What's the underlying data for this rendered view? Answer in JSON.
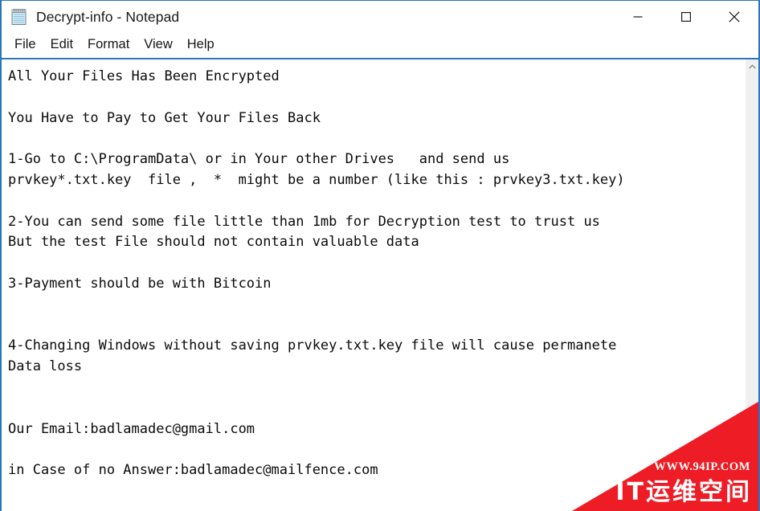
{
  "window": {
    "title": "Decrypt-info - Notepad",
    "icon": "notepad-icon",
    "controls": {
      "minimize_label": "Minimize",
      "maximize_label": "Maximize",
      "close_label": "Close"
    },
    "accent_color": "#2a76b8"
  },
  "menu": {
    "items": [
      {
        "label": "File"
      },
      {
        "label": "Edit"
      },
      {
        "label": "Format"
      },
      {
        "label": "View"
      },
      {
        "label": "Help"
      }
    ]
  },
  "document": {
    "lines": [
      "All Your Files Has Been Encrypted",
      "",
      "You Have to Pay to Get Your Files Back",
      "",
      "1-Go to C:\\ProgramData\\ or in Your other Drives   and send us",
      "prvkey*.txt.key  file ,  *  might be a number (like this : prvkey3.txt.key)",
      "",
      "2-You can send some file little than 1mb for Decryption test to trust us",
      "But the test File should not contain valuable data",
      "",
      "3-Payment should be with Bitcoin",
      "",
      "",
      "4-Changing Windows without saving prvkey.txt.key file will cause permanete",
      "Data loss",
      "",
      "",
      "Our Email:badlamadec@gmail.com",
      "",
      "in Case of no Answer:badlamadec@mailfence.com"
    ]
  },
  "scrollbar": {
    "up_arrow": "chevron-up-icon",
    "down_arrow": "chevron-down-icon"
  },
  "watermark": {
    "url_text": "WWW.94IP.COM",
    "brand_text": "IT运维空间",
    "color": "#ee1c25"
  }
}
